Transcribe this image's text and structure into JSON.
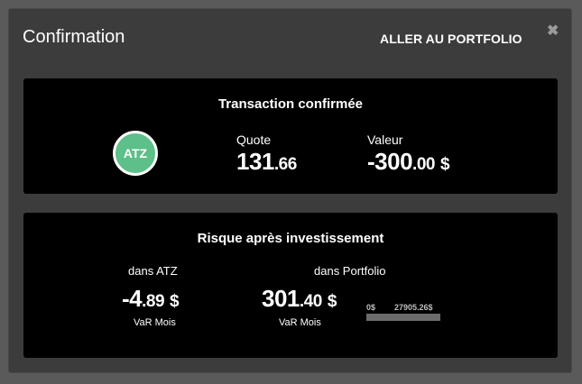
{
  "modal": {
    "title": "Confirmation",
    "portfolio_link": "ALLER AU PORTFOLIO",
    "close_symbol": "✖"
  },
  "transaction": {
    "title": "Transaction confirmée",
    "ticker": "ATZ",
    "ticker_color": "#5dbf89",
    "quote_label": "Quote",
    "quote_int": "131",
    "quote_dec": ".66",
    "value_label": "Valeur",
    "value_int": "-300",
    "value_dec": ".00",
    "value_currency": "$"
  },
  "risk": {
    "title": "Risque après investissement",
    "atz_label": "dans ATZ",
    "atz_int": "-4",
    "atz_dec": ".89",
    "atz_currency": "$",
    "atz_sub": "VaR Mois",
    "portfolio_label": "dans Portfolio",
    "portfolio_int": "301",
    "portfolio_dec": ".40",
    "portfolio_currency": "$",
    "portfolio_sub": "VaR Mois",
    "bar_min": "0$",
    "bar_max": "27905.26$"
  }
}
